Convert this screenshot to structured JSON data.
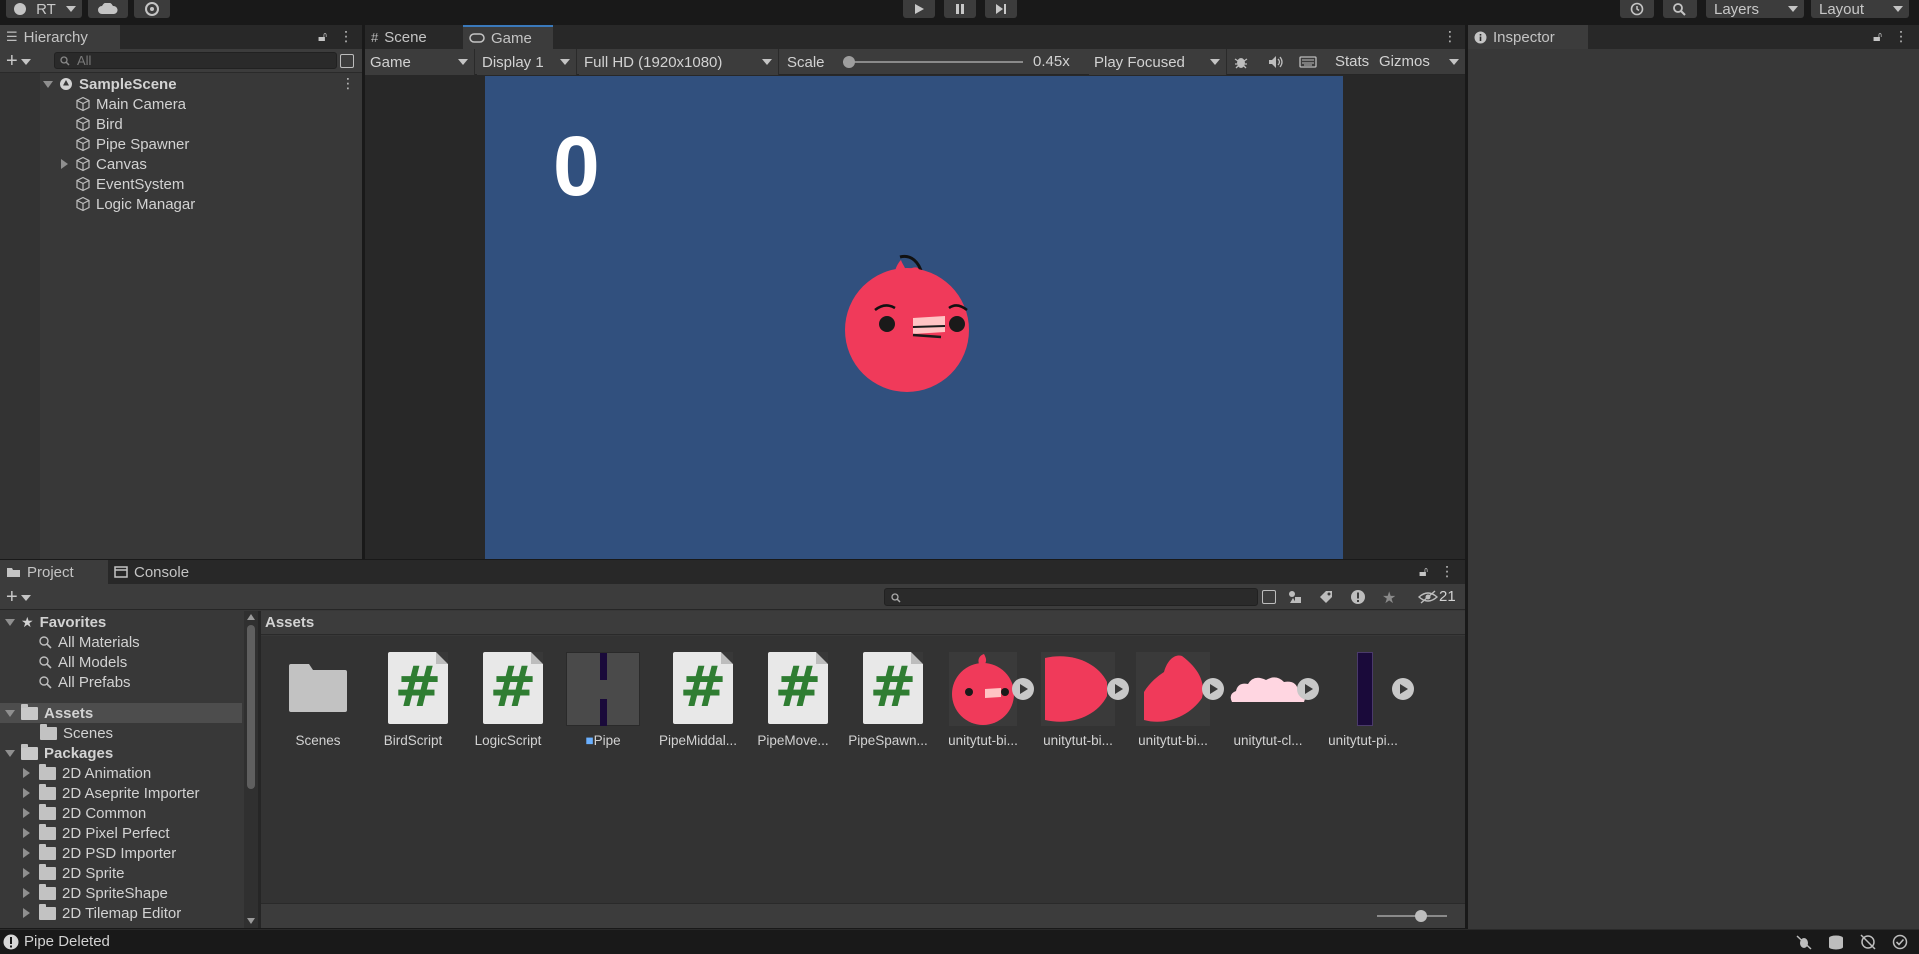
{
  "toolbar": {
    "account_label": "RT",
    "layers_label": "Layers",
    "layout_label": "Layout"
  },
  "hierarchy": {
    "tab_label": "Hierarchy",
    "search_placeholder": "All",
    "scene_name": "SampleScene",
    "objects": [
      "Main Camera",
      "Bird",
      "Pipe Spawner",
      "Canvas",
      "EventSystem",
      "Logic Managar"
    ]
  },
  "center_tabs": {
    "scene": "Scene",
    "game": "Game"
  },
  "game_toolbar": {
    "mode": "Game",
    "display": "Display 1",
    "resolution": "Full HD (1920x1080)",
    "scale_label": "Scale",
    "scale_value": "0.45x",
    "scale_fraction": 0.0,
    "play_mode": "Play Focused",
    "stats": "Stats",
    "gizmos": "Gizmos"
  },
  "game_view": {
    "score": "0",
    "background_color": "#31507e",
    "bird_color": "#f03a5a"
  },
  "inspector": {
    "tab_label": "Inspector"
  },
  "project": {
    "tab_project": "Project",
    "tab_console": "Console",
    "hidden_count": "21",
    "breadcrumb": "Assets",
    "favorites": {
      "label": "Favorites",
      "items": [
        "All Materials",
        "All Models",
        "All Prefabs"
      ]
    },
    "assets_label": "Assets",
    "assets_children": [
      "Scenes"
    ],
    "packages_label": "Packages",
    "packages": [
      "2D Animation",
      "2D Aseprite Importer",
      "2D Common",
      "2D Pixel Perfect",
      "2D PSD Importer",
      "2D Sprite",
      "2D SpriteShape",
      "2D Tilemap Editor"
    ],
    "assets": [
      "Scenes",
      "BirdScript",
      "LogicScript",
      "Pipe",
      "PipeMiddal...",
      "PipeMove...",
      "PipeSpawn...",
      "unitytut-bi...",
      "unitytut-bi...",
      "unitytut-bi...",
      "unitytut-cl...",
      "unitytut-pi..."
    ]
  },
  "status_bar": {
    "message": "Pipe Deleted"
  }
}
